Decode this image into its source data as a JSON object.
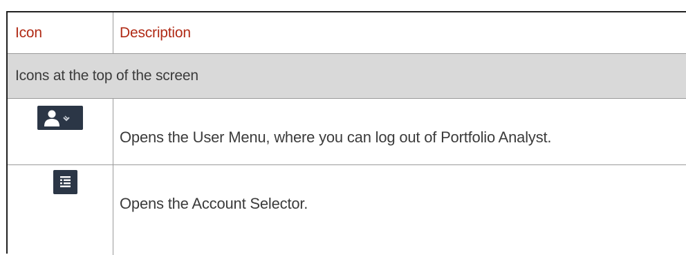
{
  "table": {
    "headers": {
      "icon": "Icon",
      "description": "Description"
    },
    "section_label": "Icons at the top of the screen",
    "rows": [
      {
        "icon": "user-menu-icon",
        "description": "Opens the User Menu, where you can log out of Portfolio Analyst."
      },
      {
        "icon": "account-selector-icon",
        "description": "Opens the Account Selector."
      }
    ]
  },
  "colors": {
    "header_text": "#b02a15",
    "body_text": "#3b3b3b",
    "section_background": "#d9d9d9",
    "icon_background": "#2b3646"
  }
}
